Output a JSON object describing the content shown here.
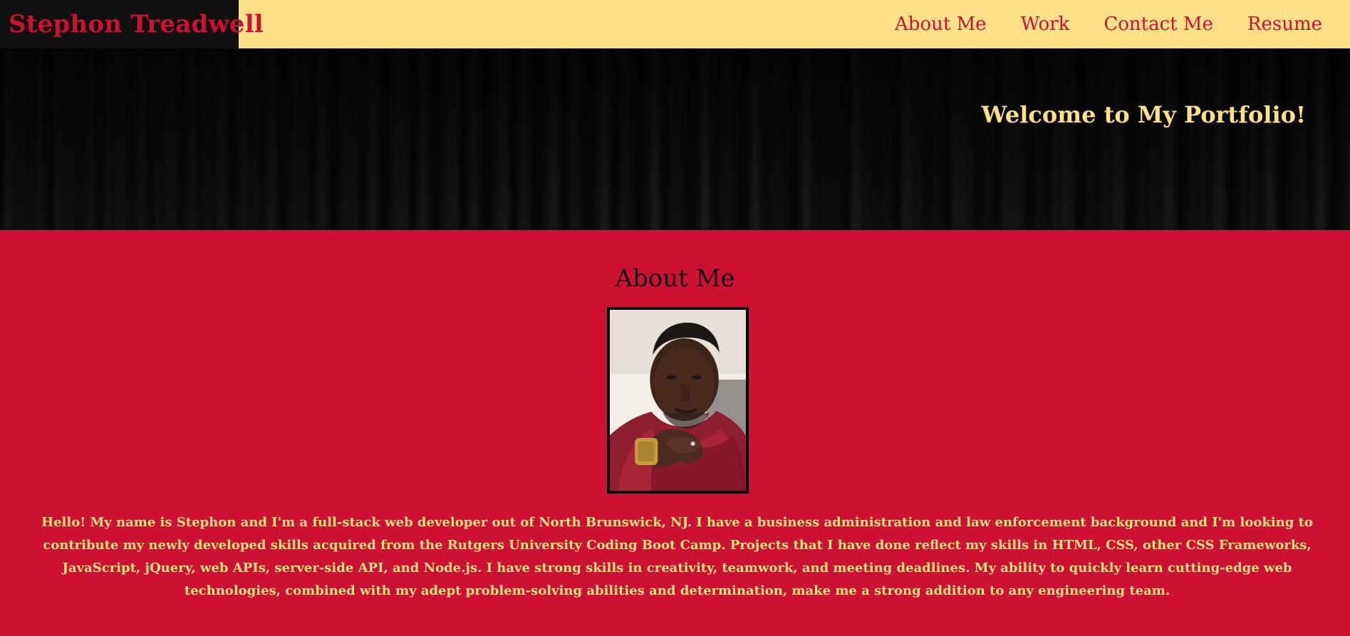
{
  "header": {
    "brand": "Stephon Treadwell",
    "nav": [
      {
        "label": "About Me"
      },
      {
        "label": "Work"
      },
      {
        "label": "Contact Me"
      },
      {
        "label": "Resume"
      }
    ]
  },
  "hero": {
    "title": "Welcome to My Portfolio!"
  },
  "about": {
    "title": "About Me",
    "bio": "Hello! My name is Stephon and I'm a full-stack web developer out of North Brunswick, NJ. I have a business administration and law enforcement background and I'm looking to contribute my newly developed skills acquired from the Rutgers University Coding Boot Camp. Projects that I have done reflect my skills in HTML, CSS, other CSS Frameworks, JavaScript, jQuery, web APIs, server-side API, and Node.js. I have strong skills in creativity, teamwork, and meeting deadlines. My ability to quickly learn cutting-edge web technologies, combined with my adept problem-solving abilities and determination, make me a strong addition to any engineering team."
  },
  "colors": {
    "brand_red": "#cc1133",
    "nav_yellow": "#ffdf88",
    "dark": "#111111"
  }
}
